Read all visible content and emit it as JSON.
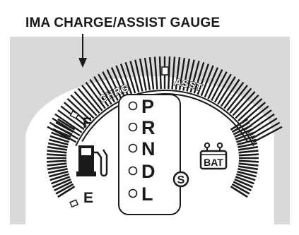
{
  "callout": {
    "title": "IMA CHARGE/ASSIST GAUGE"
  },
  "ima_gauge": {
    "left_label": "CHRG",
    "right_label": "ASST"
  },
  "fuel_gauge": {
    "full_label": "F",
    "empty_label": "E",
    "icon": "fuel-pump-icon"
  },
  "gear_indicator": {
    "positions": [
      "P",
      "R",
      "N",
      "D",
      "L"
    ],
    "sport_mode_label": "S"
  },
  "battery_gauge": {
    "label": "BAT",
    "icon": "battery-icon"
  },
  "colors": {
    "ink": "#1a1a1a",
    "panel": "#d9d9d9",
    "background": "#ffffff"
  }
}
